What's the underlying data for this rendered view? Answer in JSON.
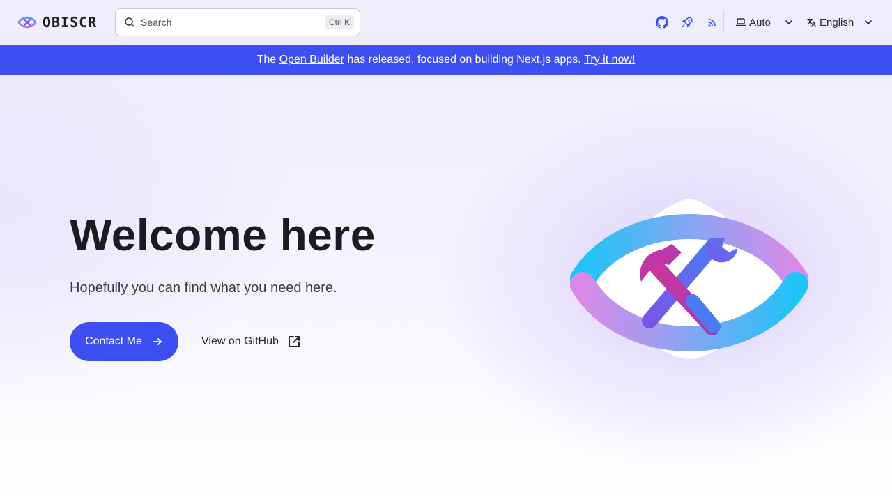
{
  "brand": {
    "name": "OBISCR",
    "logo_icon": "eye-tools-logo-icon"
  },
  "search": {
    "placeholder": "Search",
    "shortcut": "Ctrl K",
    "icon": "search-icon"
  },
  "nav": {
    "icons": [
      "github-icon",
      "rocket-icon",
      "rss-icon"
    ],
    "theme": {
      "label": "Auto",
      "icon": "laptop-icon"
    },
    "language": {
      "label": "English",
      "icon": "translate-icon"
    }
  },
  "banner": {
    "prefix": "The ",
    "link1": "Open Builder",
    "middle": " has released, focused on building Next.js apps. ",
    "link2": "Try it now!"
  },
  "hero": {
    "title": "Welcome here",
    "subtitle": "Hopefully you can find what you need here.",
    "primary_button": "Contact Me",
    "secondary_link": "View on GitHub"
  },
  "colors": {
    "accent": "#3d4ff0",
    "gradient_cyan": "#1fc4f7",
    "gradient_pink": "#d98ae8",
    "tool_magenta": "#c02fa0",
    "tool_blue": "#4a6ef0"
  }
}
